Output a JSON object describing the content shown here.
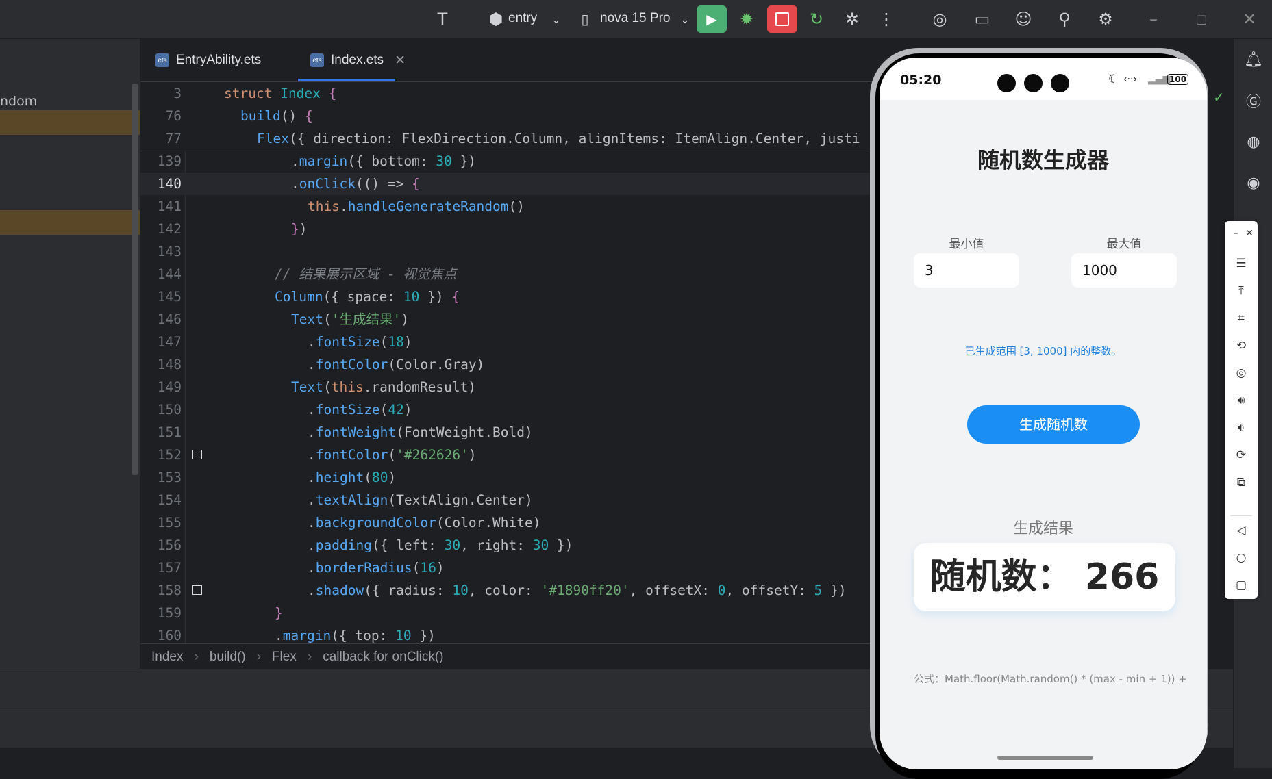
{
  "toolbar": {
    "module": "entry",
    "device": "nova 15 Pro"
  },
  "project_tree": {
    "partial_item": "ndom"
  },
  "tabs": [
    {
      "label": "EntryAbility.ets"
    },
    {
      "label": "Index.ets"
    }
  ],
  "code_lines": [
    {
      "n": "3",
      "text": "struct Index {"
    },
    {
      "n": "76",
      "text": "  build() {"
    },
    {
      "n": "77",
      "text": "    Flex({ direction: FlexDirection.Column, alignItems: ItemAlign.Center, justi"
    },
    {
      "n": "139",
      "text": "        .margin({ bottom: 30 })"
    },
    {
      "n": "140",
      "text": "        .onClick(() => {"
    },
    {
      "n": "141",
      "text": "          this.handleGenerateRandom()"
    },
    {
      "n": "142",
      "text": "        })"
    },
    {
      "n": "143",
      "text": ""
    },
    {
      "n": "144",
      "text": "      // 结果展示区域 - 视觉焦点"
    },
    {
      "n": "145",
      "text": "      Column({ space: 10 }) {"
    },
    {
      "n": "146",
      "text": "        Text('生成结果')"
    },
    {
      "n": "147",
      "text": "          .fontSize(18)"
    },
    {
      "n": "148",
      "text": "          .fontColor(Color.Gray)"
    },
    {
      "n": "149",
      "text": "        Text(this.randomResult)"
    },
    {
      "n": "150",
      "text": "          .fontSize(42)"
    },
    {
      "n": "151",
      "text": "          .fontWeight(FontWeight.Bold)"
    },
    {
      "n": "152",
      "text": "          .fontColor('#262626')"
    },
    {
      "n": "153",
      "text": "          .height(80)"
    },
    {
      "n": "154",
      "text": "          .textAlign(TextAlign.Center)"
    },
    {
      "n": "155",
      "text": "          .backgroundColor(Color.White)"
    },
    {
      "n": "156",
      "text": "          .padding({ left: 30, right: 30 })"
    },
    {
      "n": "157",
      "text": "          .borderRadius(16)"
    },
    {
      "n": "158",
      "text": "          .shadow({ radius: 10, color: '#1890ff20', offsetX: 0, offsetY: 5 })"
    },
    {
      "n": "159",
      "text": "      }"
    },
    {
      "n": "160",
      "text": "      .margin({ top: 10 })"
    }
  ],
  "breadcrumbs": [
    "Index",
    "build()",
    "Flex",
    "callback for onClick()"
  ],
  "phone": {
    "time": "05:20",
    "battery": "100",
    "title": "随机数生成器",
    "min_label": "最小值",
    "max_label": "最大值",
    "min_value": "3",
    "max_value": "1000",
    "info": "已生成范围 [3, 1000] 内的整数。",
    "button": "生成随机数",
    "result_label": "生成结果",
    "result": "随机数：  266",
    "formula": "公式：Math.floor(Math.random() * (max - min + 1)) + …"
  },
  "colors": {
    "accent": "#1a8ef4",
    "run_button": "#4caf73",
    "stop_button": "#e5484d"
  }
}
